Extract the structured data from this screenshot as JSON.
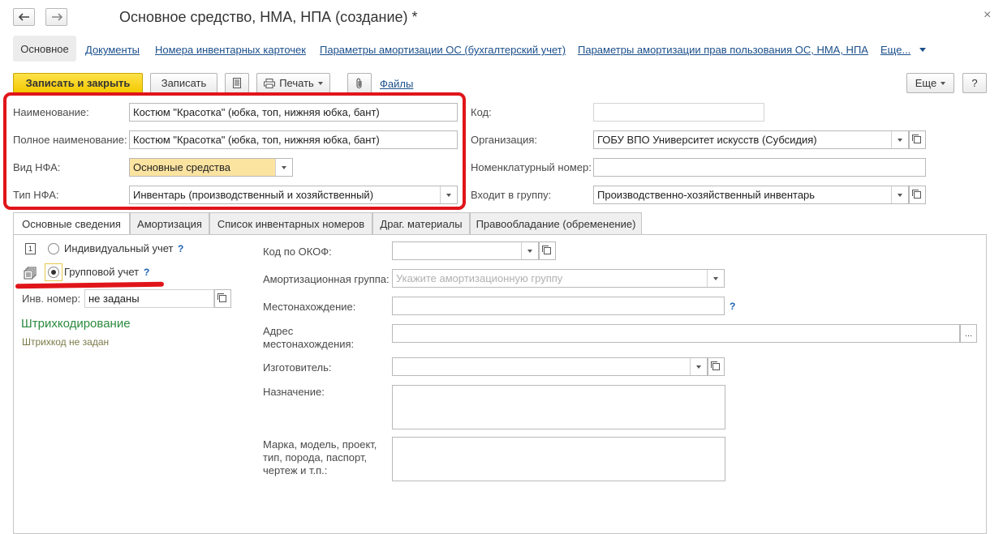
{
  "window": {
    "title": "Основное средство, НМА, НПА (создание) *",
    "close_glyph": "×"
  },
  "nav": {
    "active": "Основное",
    "links": [
      "Документы",
      "Номера инвентарных карточек",
      "Параметры амортизации ОС (бухгалтерский учет)",
      "Параметры амортизации прав пользования ОС, НМА, НПА",
      "Еще..."
    ]
  },
  "toolbar": {
    "save_close": "Записать и закрыть",
    "save": "Записать",
    "print": "Печать",
    "files": "Файлы",
    "more": "Еще",
    "help": "?"
  },
  "form": {
    "name_label": "Наименование:",
    "name_value": "Костюм \"Красотка\" (юбка, топ, нижняя юбка, бант)",
    "fullname_label": "Полное наименование:",
    "fullname_value": "Костюм \"Красотка\" (юбка, топ, нижняя юбка, бант)",
    "vid_label": "Вид НФА:",
    "vid_value": "Основные средства",
    "tip_label": "Тип НФА:",
    "tip_value": "Инвентарь (производственный и хозяйственный)",
    "code_label": "Код:",
    "code_value": "",
    "org_label": "Организация:",
    "org_value": "ГОБУ ВПО Университет искусств (Субсидия)",
    "nomen_label": "Номенклатурный номер:",
    "nomen_value": "",
    "group_label": "Входит в группу:",
    "group_value": "Производственно-хозяйственный инвентарь"
  },
  "tabs": [
    "Основные сведения",
    "Амортизация",
    "Список инвентарных номеров",
    "Драг. материалы",
    "Правообладание (обременение)"
  ],
  "main": {
    "individual_icon": "1",
    "individual_label": "Индивидуальный учет",
    "group_label": "Групповой учет",
    "help": "?",
    "inv_label": "Инв. номер:",
    "inv_value": "не заданы",
    "barcode_title": "Штрихкодирование",
    "barcode_status": "Штрихкод не задан",
    "okof_label": "Код по ОКОФ:",
    "okof_value": "",
    "amort_label": "Амортизационная группа:",
    "amort_placeholder": "Укажите амортизационную группу",
    "location_label": "Местонахождение:",
    "location_value": "",
    "address_label_1": "Адрес",
    "address_label_2": "местонахождения:",
    "address_value": "",
    "address_btn": "...",
    "maker_label": "Изготовитель:",
    "maker_value": "",
    "purpose_label": "Назначение:",
    "brand_label_1": "Марка, модель, проект,",
    "brand_label_2": "тип, порода, паспорт,",
    "brand_label_3": "чертеж и т.п.:"
  },
  "colors": {
    "highlight_red": "#e0151a",
    "link_blue": "#1b4f8b",
    "primary_yellow": "#f4c900",
    "field_yellow": "#fbe3a0",
    "green_title": "#2b8a3e"
  },
  "icons": [
    "arrow-left-icon",
    "arrow-right-icon",
    "close-icon",
    "list-icon",
    "printer-icon",
    "paperclip-icon",
    "chevron-down-icon",
    "open-form-icon",
    "individual-icon",
    "group-icon"
  ]
}
